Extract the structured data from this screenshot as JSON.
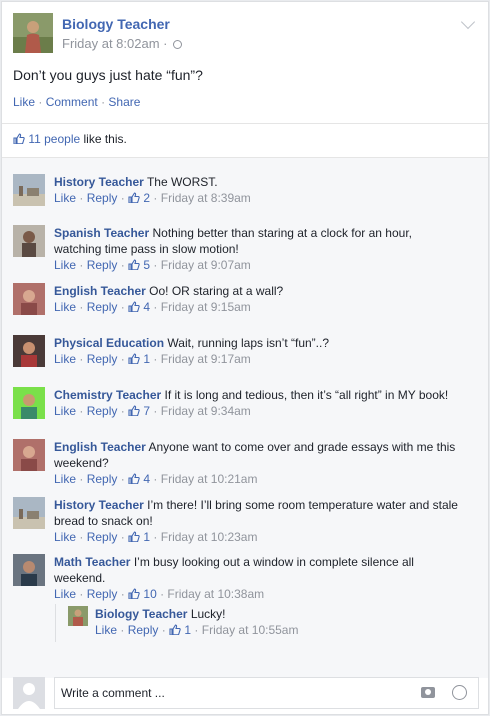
{
  "post": {
    "author": "Biology Teacher",
    "timestamp": "Friday at 8:02am ·",
    "text": "Don’t you guys just hate “fun”?",
    "actions": {
      "like": "Like",
      "comment": "Comment",
      "share": "Share"
    }
  },
  "likes": {
    "count": "11 people",
    "suffix": " like this."
  },
  "comments": [
    {
      "author": "History Teacher",
      "text": "The WORST.",
      "like": "Like",
      "reply": "Reply",
      "likes": "2",
      "time": "Friday at 8:39am"
    },
    {
      "author": "Spanish Teacher",
      "text": "Nothing better than staring at a clock for an hour, watching time pass in slow motion!",
      "like": "Like",
      "reply": "Reply",
      "likes": "5",
      "time": "Friday at 9:07am"
    },
    {
      "author": "English Teacher",
      "text": "Oo! OR staring at a wall?",
      "like": "Like",
      "reply": "Reply",
      "likes": "4",
      "time": "Friday at 9:15am"
    },
    {
      "author": "Physical Education",
      "text": "Wait, running laps isn’t “fun”..?",
      "like": "Like",
      "reply": "Reply",
      "likes": "1",
      "time": "Friday at 9:17am"
    },
    {
      "author": "Chemistry Teacher",
      "text": "If it is long and tedious, then it’s “all right” in MY book!",
      "like": "Like",
      "reply": "Reply",
      "likes": "7",
      "time": "Friday at 9:34am"
    },
    {
      "author": "English Teacher",
      "text": "Anyone want to come over and grade essays with me this weekend?",
      "like": "Like",
      "reply": "Reply",
      "likes": "4",
      "time": "Friday at 10:21am"
    },
    {
      "author": "History Teacher",
      "text": "I’m there! I’ll bring some room temperature water and stale bread to snack on!",
      "like": "Like",
      "reply": "Reply",
      "likes": "1",
      "time": "Friday at 10:23am"
    },
    {
      "author": "Math Teacher",
      "text": "I’m busy looking out a window in complete silence all weekend.",
      "like": "Like",
      "reply": "Reply",
      "likes": "10",
      "time": "Friday at 10:38am"
    }
  ],
  "reply": {
    "author": "Biology Teacher",
    "text": "Lucky!",
    "like": "Like",
    "reply": "Reply",
    "likes": "1",
    "time": "Friday at 10:55am"
  },
  "composer": {
    "placeholder": "Write a comment ..."
  },
  "colors": {
    "link": "#4267b2",
    "name": "#365899",
    "meta": "#90949c",
    "comments_bg": "#f6f7f9"
  },
  "icons": [
    "chevron-down-icon",
    "globe-icon",
    "thumbs-up-icon",
    "camera-icon",
    "smiley-icon"
  ]
}
